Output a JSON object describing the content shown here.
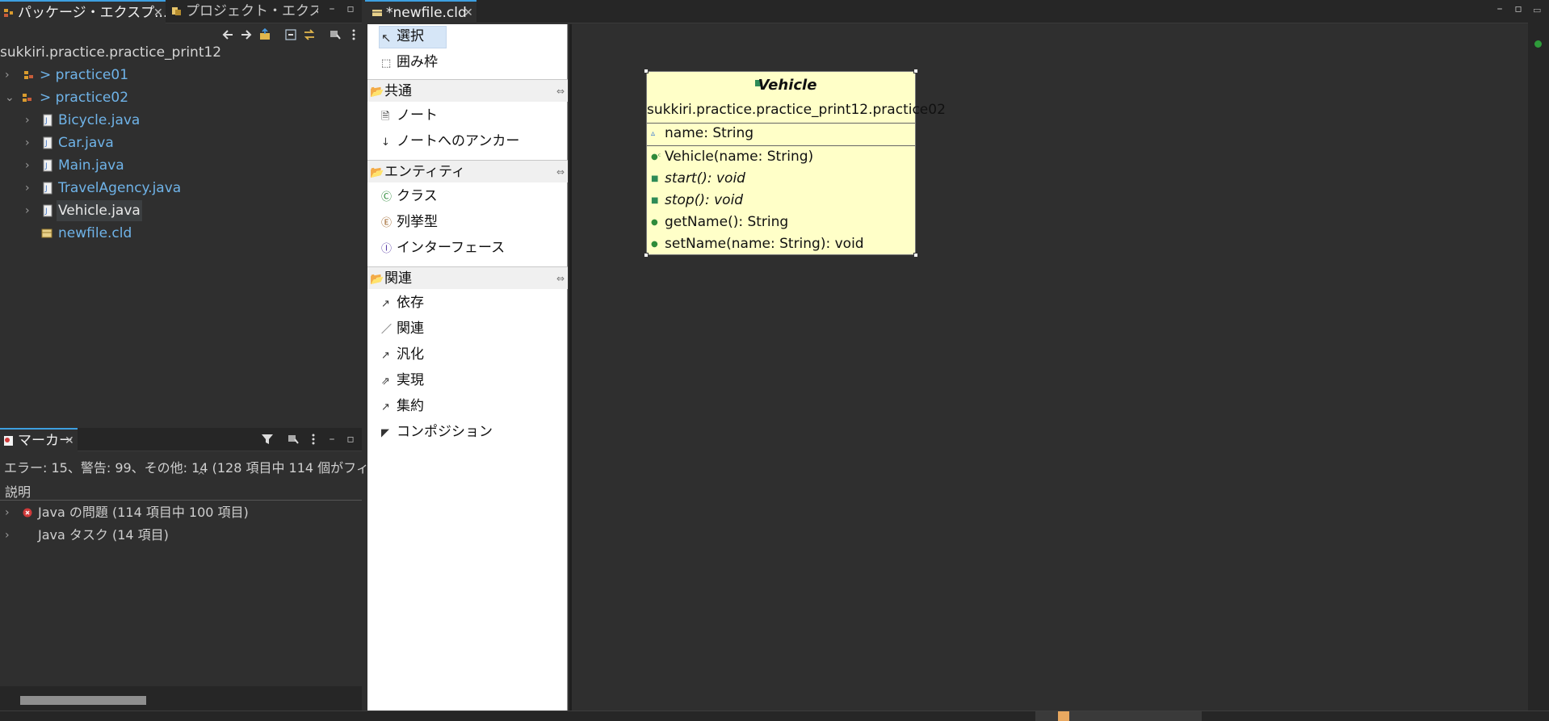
{
  "package_explorer": {
    "tabs": [
      {
        "label": "パッケージ・エクスプ..."
      },
      {
        "label": "プロジェクト・エクスプ..."
      }
    ],
    "root_label": "sukkiri.practice.practice_print12",
    "items": [
      {
        "label": "> practice01",
        "expanded": false
      },
      {
        "label": "> practice02",
        "expanded": true
      },
      {
        "label": "Bicycle.java"
      },
      {
        "label": "Car.java"
      },
      {
        "label": "Main.java"
      },
      {
        "label": "TravelAgency.java"
      },
      {
        "label": "Vehicle.java"
      },
      {
        "label": "newfile.cld"
      }
    ]
  },
  "markers": {
    "tab_label": "マーカー",
    "summary": "エラー: 15、警告: 99、その他: 14 (128 項目中 114 個がフィル",
    "column_header": "説明",
    "rows": [
      {
        "label": "Java の問題 (114 項目中 100 項目)",
        "icon": "error-icon"
      },
      {
        "label": "Java タスク (14 項目)"
      }
    ]
  },
  "editor": {
    "tab_label": "*newfile.cld",
    "palette": {
      "tools": [
        {
          "label": "選択"
        },
        {
          "label": "囲み枠"
        }
      ],
      "sections": [
        {
          "label": "共通",
          "items": [
            {
              "label": "ノート"
            },
            {
              "label": "ノートへのアンカー"
            }
          ]
        },
        {
          "label": "エンティティ",
          "items": [
            {
              "label": "クラス"
            },
            {
              "label": "列挙型"
            },
            {
              "label": "インターフェース"
            }
          ]
        },
        {
          "label": "関連",
          "items": [
            {
              "label": "依存"
            },
            {
              "label": "関連"
            },
            {
              "label": "汎化"
            },
            {
              "label": "実現"
            },
            {
              "label": "集約"
            },
            {
              "label": "コンポジション"
            }
          ]
        }
      ]
    },
    "uml_class": {
      "name": "Vehicle",
      "package": "sukkiri.practice.practice_print12.practice02",
      "attributes": [
        {
          "label": "name: String"
        }
      ],
      "operations": [
        {
          "label": "Vehicle(name: String)",
          "italic": false
        },
        {
          "label": "start(): void",
          "italic": true
        },
        {
          "label": "stop(): void",
          "italic": true
        },
        {
          "label": "getName(): String",
          "italic": false
        },
        {
          "label": "setName(name: String): void",
          "italic": false
        }
      ]
    }
  },
  "colors": {
    "link": "#6fb3e8",
    "uml_fill": "#ffffc8",
    "accent": "#3d9fe0"
  }
}
